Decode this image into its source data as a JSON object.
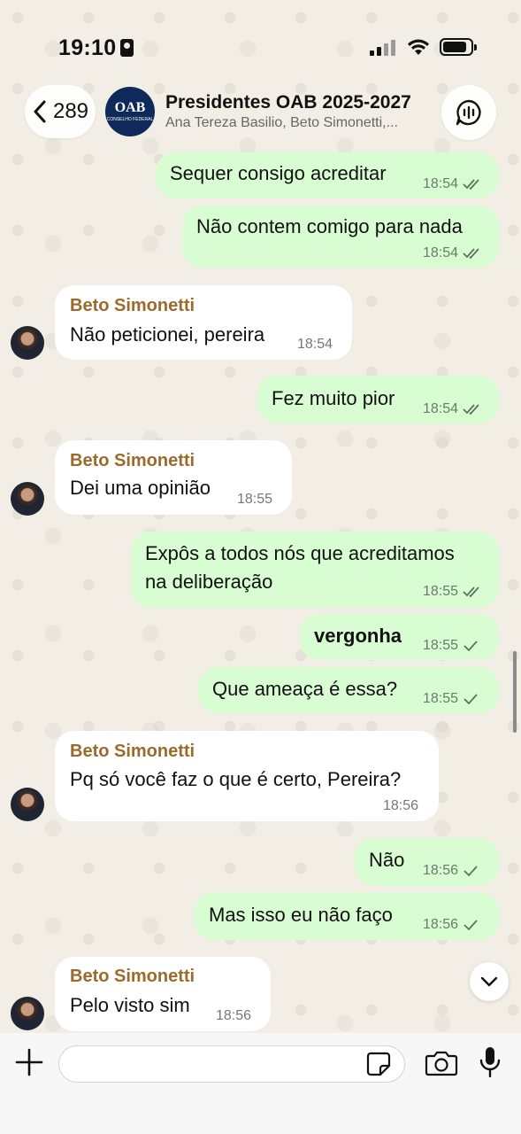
{
  "status_bar": {
    "time": "19:10"
  },
  "header": {
    "back_count": "289",
    "group_avatar_text": "OAB",
    "group_avatar_sub": "CONSELHO FEDERAL",
    "title": "Presidentes OAB 2025-2027",
    "subtitle": "Ana Tereza Basilio, Beto Simonetti,..."
  },
  "messages": [
    {
      "direction": "out",
      "text": "Sequer consigo acreditar",
      "time": "18:54",
      "status": "read"
    },
    {
      "direction": "out",
      "text": "Não contem comigo para nada",
      "time": "18:54",
      "status": "read"
    },
    {
      "direction": "in",
      "sender": "Beto Simonetti",
      "text": "Não peticionei, pereira",
      "time": "18:54"
    },
    {
      "direction": "out",
      "text": "Fez muito pior",
      "time": "18:54",
      "status": "read"
    },
    {
      "direction": "in",
      "sender": "Beto Simonetti",
      "text": "Dei uma opinião",
      "time": "18:55"
    },
    {
      "direction": "out",
      "text_line1": "Expôs a todos nós que acreditamos",
      "text_line2": "na deliberação",
      "time": "18:55",
      "status": "read"
    },
    {
      "direction": "out",
      "text": "vergonha",
      "time": "18:55",
      "status": "sent",
      "bold": true
    },
    {
      "direction": "out",
      "text": "Que ameaça é essa?",
      "time": "18:55",
      "status": "sent"
    },
    {
      "direction": "in",
      "sender": "Beto Simonetti",
      "text": "Pq só você faz o que é certo, Pereira?",
      "time": "18:56"
    },
    {
      "direction": "out",
      "text": "Não",
      "time": "18:56",
      "status": "sent"
    },
    {
      "direction": "out",
      "text": "Mas isso eu não faço",
      "time": "18:56",
      "status": "sent"
    },
    {
      "direction": "in",
      "sender": "Beto Simonetti",
      "text": "Pelo visto sim",
      "time": "18:56"
    }
  ],
  "input": {
    "placeholder": ""
  },
  "colors": {
    "outgoing_bubble": "#d9fdd3",
    "incoming_bubble": "#ffffff",
    "sender_name": "#9a6b2b",
    "read_tick": "#5f6f5f"
  },
  "icons": [
    "back-chevron-icon",
    "call-waveform-icon",
    "double-check-icon",
    "single-check-icon",
    "chevron-down-icon",
    "plus-icon",
    "sticker-icon",
    "camera-icon",
    "microphone-icon"
  ]
}
